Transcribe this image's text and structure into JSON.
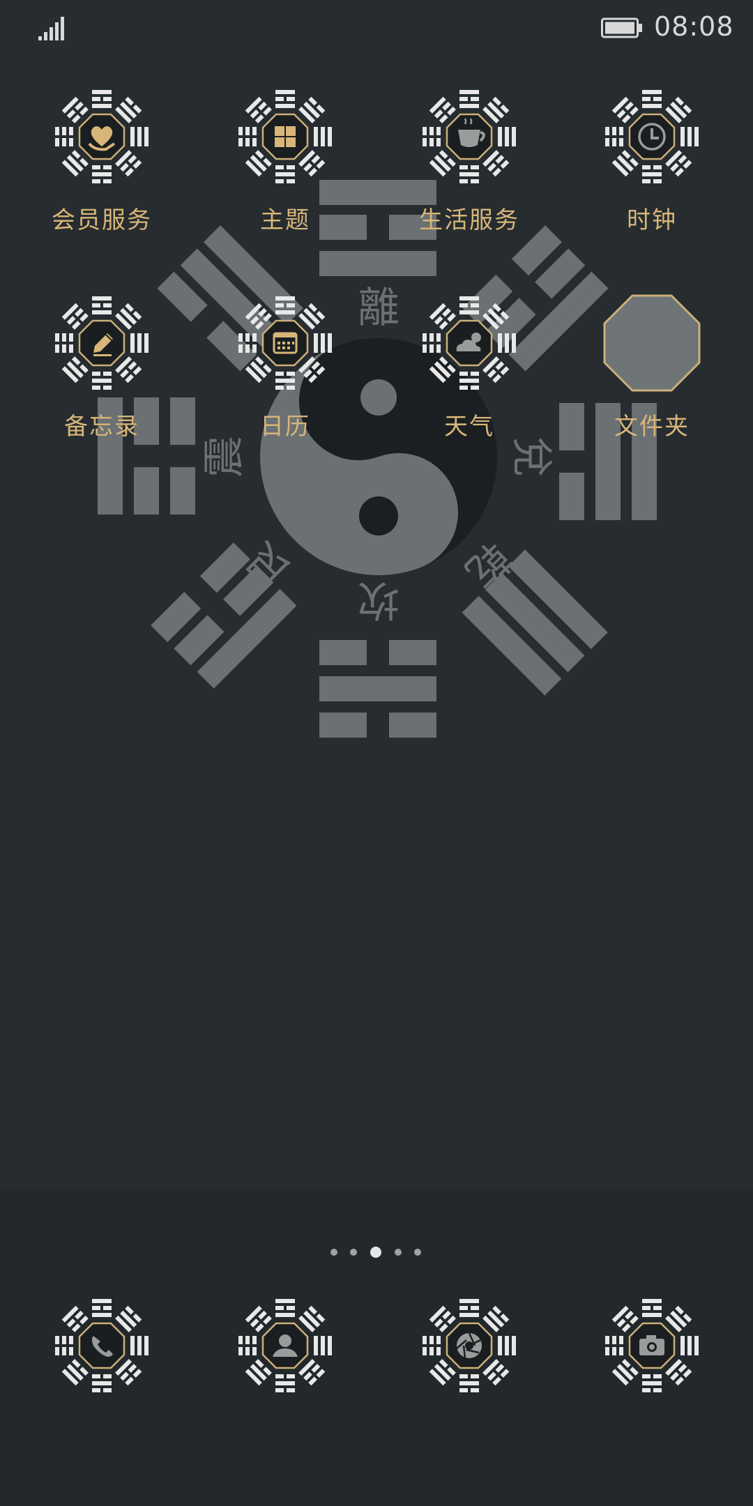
{
  "status_bar": {
    "time": "08:08",
    "signal_icon": "signal-icon",
    "battery_icon": "battery-icon"
  },
  "wallpaper": {
    "trigram_labels": [
      "離",
      "兌",
      "乾",
      "坎",
      "艮",
      "震"
    ],
    "colors": {
      "background": "#262c2f",
      "trigram": "#6b7073",
      "yin": "#1b1f21",
      "yang": "#6b7073"
    }
  },
  "apps": [
    {
      "label": "会员服务",
      "icon": "heart-hand-icon"
    },
    {
      "label": "主题",
      "icon": "grid-icon"
    },
    {
      "label": "生活服务",
      "icon": "teacup-icon"
    },
    {
      "label": "时钟",
      "icon": "clock-icon"
    },
    {
      "label": "备忘录",
      "icon": "pencil-icon"
    },
    {
      "label": "日历",
      "icon": "calendar-icon"
    },
    {
      "label": "天气",
      "icon": "weather-icon"
    },
    {
      "label": "文件夹",
      "icon": "folder-icon"
    }
  ],
  "page_indicator": {
    "count": 5,
    "active": 3
  },
  "dock": [
    {
      "icon": "phone-icon"
    },
    {
      "icon": "contacts-icon"
    },
    {
      "icon": "aperture-icon"
    },
    {
      "icon": "camera-icon"
    }
  ],
  "colors": {
    "accent": "#d8b679",
    "icon_bg": "#1a1e20",
    "trigram_white": "#e8e8e8"
  }
}
